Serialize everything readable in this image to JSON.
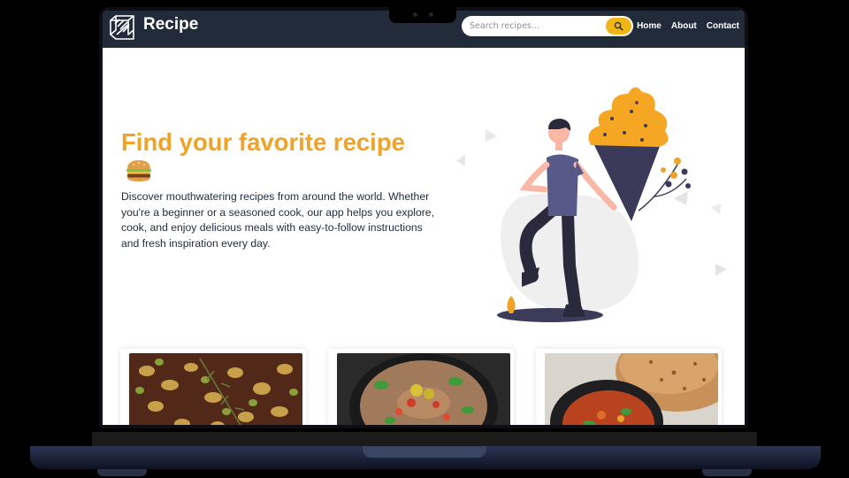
{
  "app": {
    "brand": "Recipe"
  },
  "search": {
    "placeholder": "Search recipes...",
    "icon": "search-icon"
  },
  "nav": {
    "links": [
      "Home",
      "About",
      "Contact"
    ]
  },
  "hero": {
    "title": "Find your favorite recipe",
    "emoji": "🍔",
    "description": "Discover mouthwatering recipes from around the world. Whether you're a beginner or a seasoned cook, our app helps you explore, cook, and enjoy delicious meals with easy-to-follow instructions and fresh inspiration every day."
  },
  "cards": [
    "chocolate-bark-image",
    "bean-dip-bowl-image",
    "curry-with-flatbread-image"
  ],
  "colors": {
    "accent": "#f0a329",
    "navbar": "#222b3a",
    "search_button": "#f2b516",
    "text": "#1f2a3a"
  }
}
